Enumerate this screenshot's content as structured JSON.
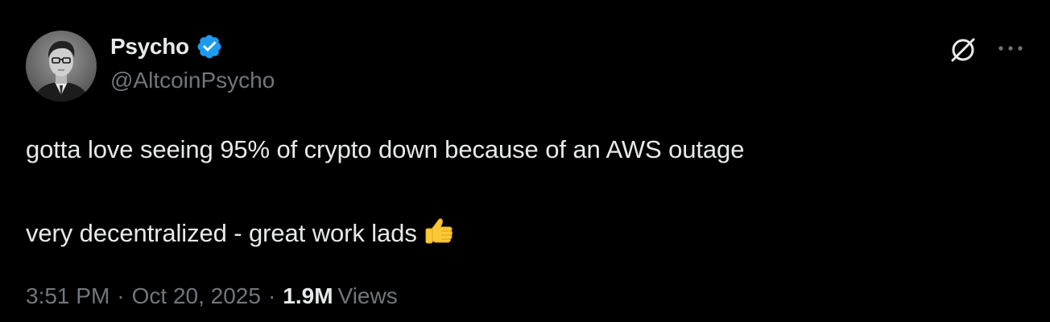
{
  "author": {
    "display_name": "Psycho",
    "handle": "@AltcoinPsycho",
    "verified": true
  },
  "tweet": {
    "line1": "gotta love seeing 95% of crypto down because of an AWS outage",
    "line2": "very decentralized - great work lads",
    "emoji_icon": "thumbs-up-icon"
  },
  "meta": {
    "time": "3:51 PM",
    "separator": "·",
    "date": "Oct 20, 2025",
    "views_count": "1.9M",
    "views_label": "Views"
  },
  "icons": {
    "verified": "verified-badge-icon",
    "grok": "grok-icon",
    "more": "more-dots-icon"
  },
  "colors": {
    "background": "#000000",
    "primary_text": "#e7e9ea",
    "secondary_text": "#71767b",
    "verified_blue": "#1d9bf0"
  }
}
